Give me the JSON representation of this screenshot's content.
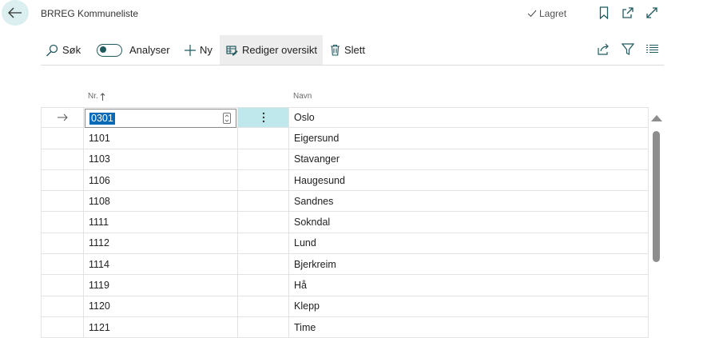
{
  "header": {
    "title": "BRREG Kommuneliste",
    "saved_status": "Lagret"
  },
  "actions": {
    "search": "Søk",
    "analyze": "Analyser",
    "new": "Ny",
    "edit_list": "Rediger oversikt",
    "delete": "Slett"
  },
  "table": {
    "col_nr": "Nr.",
    "col_navn": "Navn",
    "selected_nr": "0301",
    "rows": [
      {
        "nr": "0301",
        "navn": "Oslo"
      },
      {
        "nr": "1101",
        "navn": "Eigersund"
      },
      {
        "nr": "1103",
        "navn": "Stavanger"
      },
      {
        "nr": "1106",
        "navn": "Haugesund"
      },
      {
        "nr": "1108",
        "navn": "Sandnes"
      },
      {
        "nr": "1111",
        "navn": "Sokndal"
      },
      {
        "nr": "1112",
        "navn": "Lund"
      },
      {
        "nr": "1114",
        "navn": "Bjerkreim"
      },
      {
        "nr": "1119",
        "navn": "Hå"
      },
      {
        "nr": "1120",
        "navn": "Klepp"
      },
      {
        "nr": "1121",
        "navn": "Time"
      }
    ]
  },
  "colors": {
    "accent": "#1f5a5f",
    "selection": "#0b69b5",
    "active_cell": "#bfe8ec",
    "back_button": "#dbeef0"
  }
}
